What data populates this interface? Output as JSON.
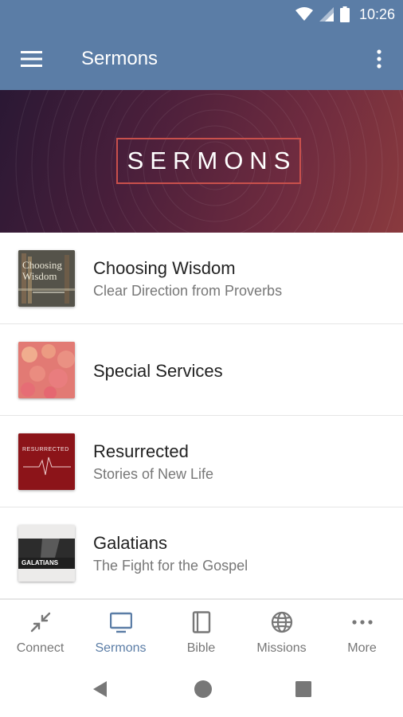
{
  "status_bar": {
    "time": "10:26"
  },
  "app_bar": {
    "title": "Sermons"
  },
  "banner": {
    "text": "SERMONS"
  },
  "series": [
    {
      "title": "Choosing Wisdom",
      "subtitle": "Clear Direction from Proverbs",
      "thumb_text": "Choosing Wisdom"
    },
    {
      "title": "Special Services",
      "subtitle": ""
    },
    {
      "title": "Resurrected",
      "subtitle": "Stories of New Life",
      "thumb_text": "RESURRECTED"
    },
    {
      "title": "Galatians",
      "subtitle": "The Fight for the Gospel",
      "thumb_text": "GALATIANS"
    }
  ],
  "bottom_nav": {
    "tabs": [
      {
        "label": "Connect",
        "icon": "connect-icon"
      },
      {
        "label": "Sermons",
        "icon": "tv-icon",
        "active": true
      },
      {
        "label": "Bible",
        "icon": "book-icon"
      },
      {
        "label": "Missions",
        "icon": "globe-icon"
      },
      {
        "label": "More",
        "icon": "more-dots-icon"
      }
    ]
  },
  "colors": {
    "primary": "#5b7da6",
    "banner_border": "#c9504c"
  }
}
